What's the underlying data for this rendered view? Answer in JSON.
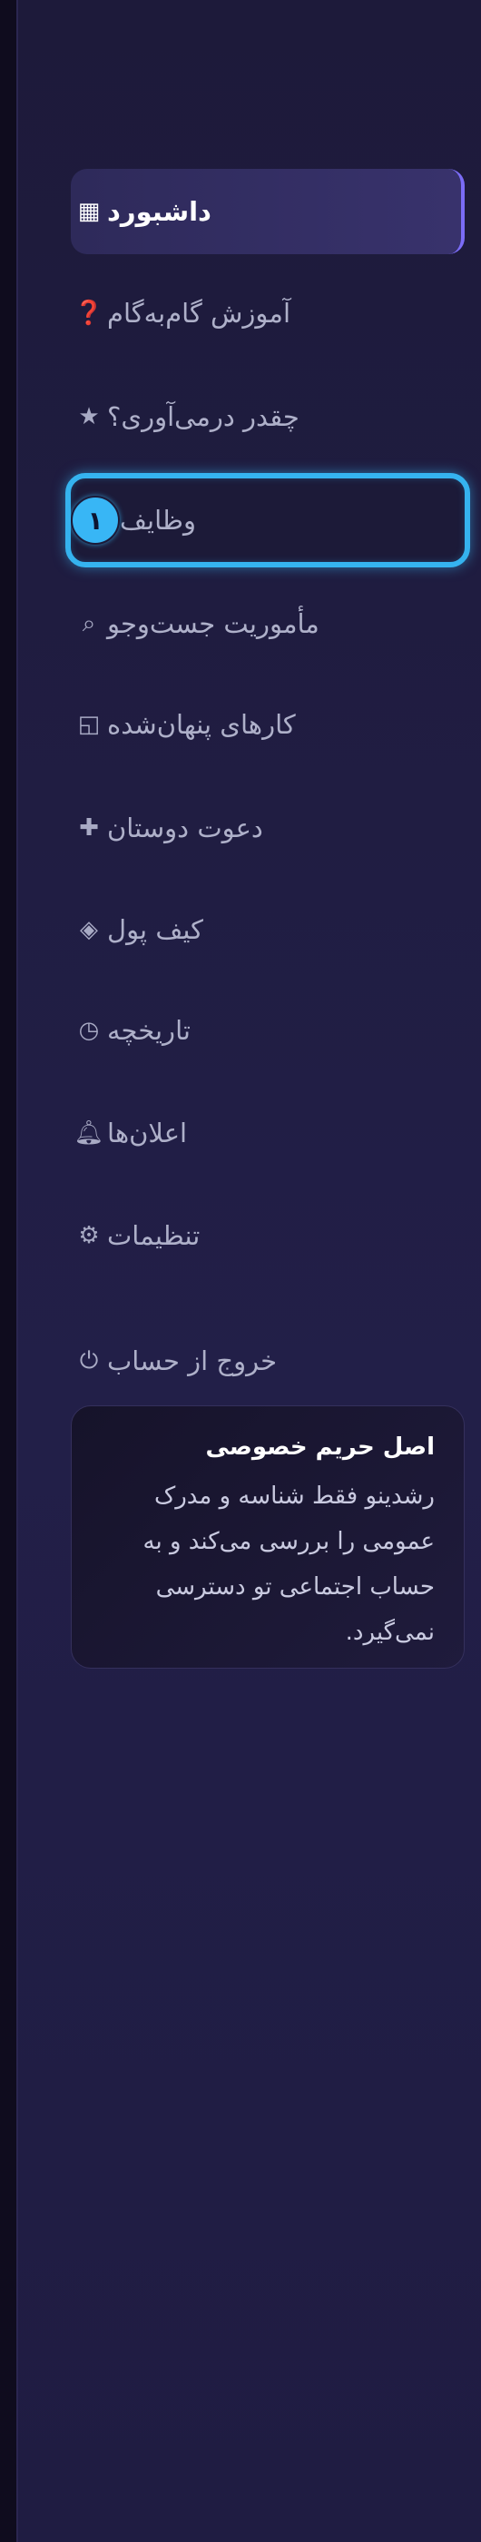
{
  "nav": {
    "items": [
      {
        "label": "داشبورد",
        "icon": "grid-icon",
        "glyph": "▦"
      },
      {
        "label": "آموزش گام‌به‌گام",
        "icon": "help-icon",
        "glyph": "❓"
      },
      {
        "label": "چقدر درمی‌آوری؟",
        "icon": "star-icon",
        "glyph": "★"
      },
      {
        "label": "وظایف",
        "badge": "۱"
      },
      {
        "label": "مأموریت جست‌وجو",
        "icon": "search-icon",
        "glyph": "⌕"
      },
      {
        "label": "کارهای پنهان‌شده",
        "icon": "hidden-box-icon",
        "glyph": "◱"
      },
      {
        "label": "دعوت دوستان",
        "icon": "plus-icon",
        "glyph": "✚"
      },
      {
        "label": "کیف پول",
        "icon": "wallet-icon",
        "glyph": "◈"
      },
      {
        "label": "تاریخچه",
        "icon": "clock-icon",
        "glyph": "◷"
      },
      {
        "label": "اعلان‌ها",
        "icon": "bell-icon",
        "glyph": "🔔︎"
      },
      {
        "label": "تنظیمات",
        "icon": "gear-icon",
        "glyph": "⚙"
      }
    ],
    "logout": {
      "label": "خروج از حساب",
      "icon": "power-icon",
      "glyph": "⏻"
    }
  },
  "privacy_card": {
    "title": "اصل حریم خصوصی",
    "body": "رشدینو فقط شناسه و مدرک عمومی را بررسی می‌کند و به حساب اجتماعی تو دسترسی نمی‌گیرد."
  },
  "colors": {
    "accent": "#7b6cf6",
    "highlight": "#35b3ef",
    "background": "#1d1a3a"
  }
}
